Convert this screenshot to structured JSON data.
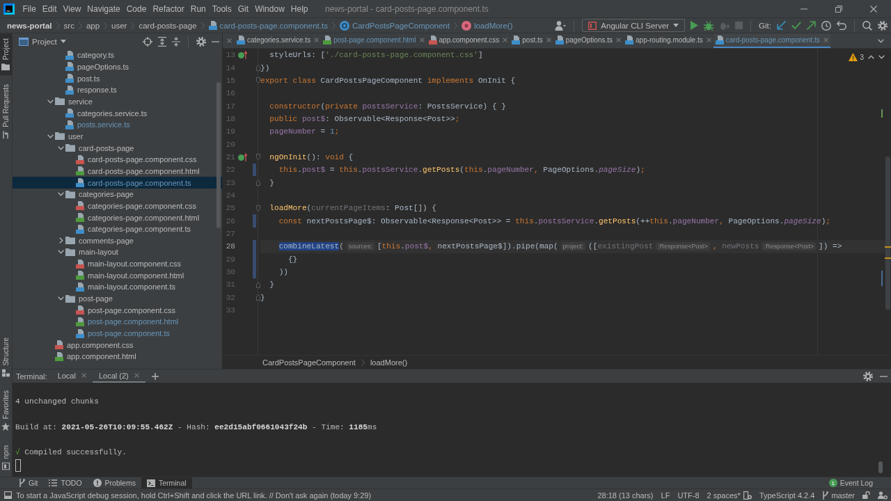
{
  "title_bar": {
    "menu": [
      "File",
      "Edit",
      "View",
      "Navigate",
      "Code",
      "Refactor",
      "Run",
      "Tools",
      "Git",
      "Window",
      "Help"
    ],
    "title": "news-portal - card-posts-page.component.ts"
  },
  "nav_bar": {
    "breadcrumbs": [
      {
        "label": "news-portal",
        "kind": "project"
      },
      {
        "label": "src",
        "kind": "folder"
      },
      {
        "label": "app",
        "kind": "folder"
      },
      {
        "label": "user",
        "kind": "folder"
      },
      {
        "label": "card-posts-page",
        "kind": "folder"
      },
      {
        "label": "card-posts-page.component.ts",
        "kind": "ts"
      },
      {
        "label": "CardPostsPageComponent",
        "kind": "class"
      },
      {
        "label": "loadMore()",
        "kind": "method"
      }
    ],
    "run_config": "Angular CLI Server",
    "git_label": "Git:"
  },
  "tool_strip": {
    "top": [
      {
        "label": "Project",
        "kind": "project",
        "selected": true
      },
      {
        "label": "Pull Requests",
        "kind": "pull_requests",
        "selected": false
      }
    ],
    "bottom": [
      {
        "label": "Structure",
        "kind": "structure",
        "selected": false
      },
      {
        "label": "Favorites",
        "kind": "favorites",
        "selected": false
      },
      {
        "label": "npm",
        "kind": "npm",
        "selected": false
      }
    ]
  },
  "project_panel": {
    "title": "Project",
    "tree": [
      {
        "children": [
          {
            "label": "category.ts",
            "kind": "ts",
            "modified": false,
            "selected": false
          },
          {
            "label": "pageOptions.ts",
            "kind": "ts",
            "modified": false,
            "selected": false
          },
          {
            "label": "post.ts",
            "kind": "ts",
            "modified": false,
            "selected": false
          },
          {
            "label": "response.ts",
            "kind": "ts",
            "modified": false,
            "selected": false
          }
        ]
      },
      {
        "label": "service",
        "kind": "folder",
        "expanded": true,
        "modified": false,
        "selected": false,
        "children": [
          {
            "label": "categories.service.ts",
            "kind": "ts",
            "modified": false,
            "selected": false
          },
          {
            "label": "posts.service.ts",
            "kind": "ts",
            "modified": true,
            "selected": false
          }
        ]
      },
      {
        "label": "user",
        "kind": "folder",
        "expanded": true,
        "modified": false,
        "selected": false,
        "children": [
          {
            "label": "card-posts-page",
            "kind": "folder",
            "expanded": true,
            "modified": false,
            "selected": false,
            "children": [
              {
                "label": "card-posts-page.component.css",
                "kind": "css",
                "modified": false,
                "selected": false
              },
              {
                "label": "card-posts-page.component.html",
                "kind": "html",
                "modified": false,
                "selected": false
              },
              {
                "label": "card-posts-page.component.ts",
                "kind": "ts",
                "modified": true,
                "selected": true
              }
            ]
          },
          {
            "label": "categories-page",
            "kind": "folder",
            "expanded": true,
            "modified": false,
            "selected": false,
            "children": [
              {
                "label": "categories-page.component.css",
                "kind": "css",
                "modified": false,
                "selected": false
              },
              {
                "label": "categories-page.component.html",
                "kind": "html",
                "modified": false,
                "selected": false
              },
              {
                "label": "categories-page.component.ts",
                "kind": "ts",
                "modified": false,
                "selected": false
              }
            ]
          },
          {
            "label": "comments-page",
            "kind": "folder",
            "expanded": false,
            "modified": false,
            "selected": false
          },
          {
            "label": "main-layout",
            "kind": "folder",
            "expanded": true,
            "modified": false,
            "selected": false,
            "children": [
              {
                "label": "main-layout.component.css",
                "kind": "css",
                "modified": false,
                "selected": false
              },
              {
                "label": "main-layout.component.html",
                "kind": "html",
                "modified": false,
                "selected": false
              },
              {
                "label": "main-layout.component.ts",
                "kind": "ts",
                "modified": false,
                "selected": false
              }
            ]
          },
          {
            "label": "post-page",
            "kind": "folder",
            "expanded": true,
            "modified": false,
            "selected": false,
            "children": [
              {
                "label": "post-page.component.css",
                "kind": "css",
                "modified": false,
                "selected": false
              },
              {
                "label": "post-page.component.html",
                "kind": "html",
                "modified": true,
                "selected": false
              },
              {
                "label": "post-page.component.ts",
                "kind": "ts",
                "modified": true,
                "selected": false
              }
            ]
          }
        ]
      },
      {
        "label": "app.component.css",
        "kind": "css",
        "modified": false,
        "selected": false
      },
      {
        "label": "app.component.html",
        "kind": "html",
        "modified": false,
        "selected": false
      }
    ]
  },
  "editor": {
    "tabs": [
      {
        "label": "categories.service.ts",
        "kind": "ts",
        "selected": false,
        "modified": false
      },
      {
        "label": "post-page.component.html",
        "kind": "html",
        "selected": false,
        "modified": true
      },
      {
        "label": "app.component.css",
        "kind": "css",
        "selected": false,
        "modified": false
      },
      {
        "label": "post.ts",
        "kind": "ts",
        "selected": false,
        "modified": false
      },
      {
        "label": "pageOptions.ts",
        "kind": "ts",
        "selected": false,
        "modified": false
      },
      {
        "label": "app-routing.module.ts",
        "kind": "ts",
        "selected": false,
        "modified": false
      },
      {
        "label": "card-posts-page.component.ts",
        "kind": "ts",
        "selected": true,
        "modified": true
      }
    ],
    "problems": "3",
    "lines": [
      {
        "number": "13",
        "kind": "plain",
        "marker": true,
        "changed": false,
        "current": false,
        "tokens": [
          {
            "text": "  styleUrls: [",
            "kind": "plain"
          },
          {
            "text": "'./card-posts-page.component.css'",
            "kind": "string"
          },
          {
            "text": "]",
            "kind": "plain"
          }
        ]
      },
      {
        "number": "14",
        "kind": "fold_end",
        "marker": false,
        "changed": false,
        "current": false,
        "tokens": [
          {
            "text": "})",
            "kind": "plain"
          }
        ]
      },
      {
        "number": "15",
        "kind": "fold_start",
        "marker": false,
        "changed": false,
        "current": false,
        "tokens": [
          {
            "text": "export class ",
            "kind": "keyword"
          },
          {
            "text": "CardPostsPageComponent ",
            "kind": "plain"
          },
          {
            "text": "implements ",
            "kind": "keyword"
          },
          {
            "text": "OnInit {",
            "kind": "plain"
          }
        ]
      },
      {
        "number": "16",
        "kind": "plain",
        "marker": false,
        "changed": false,
        "current": false
      },
      {
        "number": "17",
        "kind": "plain",
        "marker": false,
        "changed": false,
        "current": false,
        "tokens": [
          {
            "text": "  constructor",
            "kind": "keyword"
          },
          {
            "text": "(",
            "kind": "plain"
          },
          {
            "text": "private ",
            "kind": "keyword"
          },
          {
            "text": "postsService",
            "kind": "field"
          },
          {
            "text": ": PostsService) { }",
            "kind": "plain"
          }
        ]
      },
      {
        "number": "18",
        "kind": "plain",
        "marker": false,
        "changed": false,
        "current": false,
        "tokens": [
          {
            "text": "  public ",
            "kind": "keyword"
          },
          {
            "text": "post$",
            "kind": "field"
          },
          {
            "text": ": Observable<Response<Post>>",
            "kind": "plain"
          },
          {
            "text": ";",
            "kind": "keyword"
          }
        ]
      },
      {
        "number": "19",
        "kind": "plain",
        "marker": false,
        "changed": false,
        "current": false,
        "tokens": [
          {
            "text": "  pageNumber",
            "kind": "field"
          },
          {
            "text": " = ",
            "kind": "plain"
          },
          {
            "text": "1",
            "kind": "number"
          },
          {
            "text": ";",
            "kind": "keyword"
          }
        ]
      },
      {
        "number": "20",
        "kind": "plain",
        "marker": false,
        "changed": false,
        "current": false
      },
      {
        "number": "21",
        "kind": "fold_start",
        "marker": true,
        "changed": false,
        "current": false,
        "tokens": [
          {
            "text": "  ngOnInit",
            "kind": "function"
          },
          {
            "text": "(): ",
            "kind": "plain"
          },
          {
            "text": "void ",
            "kind": "keyword"
          },
          {
            "text": "{",
            "kind": "plain"
          }
        ]
      },
      {
        "number": "22",
        "kind": "plain",
        "marker": false,
        "changed": true,
        "current": false,
        "tokens": [
          {
            "text": "    this",
            "kind": "keyword"
          },
          {
            "text": ".",
            "kind": "plain"
          },
          {
            "text": "post$",
            "kind": "field"
          },
          {
            "text": " = ",
            "kind": "plain"
          },
          {
            "text": "this",
            "kind": "keyword"
          },
          {
            "text": ".",
            "kind": "plain"
          },
          {
            "text": "postsService",
            "kind": "field"
          },
          {
            "text": ".",
            "kind": "plain"
          },
          {
            "text": "getPosts",
            "kind": "function"
          },
          {
            "text": "(",
            "kind": "plain"
          },
          {
            "text": "this",
            "kind": "keyword"
          },
          {
            "text": ".",
            "kind": "plain"
          },
          {
            "text": "pageNumber",
            "kind": "field"
          },
          {
            "text": ", ",
            "kind": "keyword"
          },
          {
            "text": "PageOptions.",
            "kind": "plain"
          },
          {
            "text": "pageSize",
            "kind": "static"
          },
          {
            "text": ")",
            "kind": "plain"
          },
          {
            "text": ";",
            "kind": "keyword"
          }
        ]
      },
      {
        "number": "23",
        "kind": "fold_end",
        "marker": false,
        "changed": false,
        "current": false,
        "tokens": [
          {
            "text": "  }",
            "kind": "plain"
          }
        ]
      },
      {
        "number": "24",
        "kind": "plain",
        "marker": false,
        "changed": false,
        "current": false
      },
      {
        "number": "25",
        "kind": "fold_start",
        "marker": false,
        "changed": false,
        "current": false,
        "tokens": [
          {
            "text": "  loadMore",
            "kind": "function"
          },
          {
            "text": "(",
            "kind": "plain"
          },
          {
            "text": "currentPageItems",
            "kind": "unused"
          },
          {
            "text": ": Post[]) {",
            "kind": "plain"
          }
        ]
      },
      {
        "number": "26",
        "kind": "plain",
        "marker": false,
        "changed": true,
        "current": false,
        "tokens": [
          {
            "text": "    const ",
            "kind": "keyword"
          },
          {
            "text": "nextPostsPage$: Observable<Response<Post>> = ",
            "kind": "plain"
          },
          {
            "text": "this",
            "kind": "keyword"
          },
          {
            "text": ".",
            "kind": "plain"
          },
          {
            "text": "postsService",
            "kind": "field"
          },
          {
            "text": ".",
            "kind": "plain"
          },
          {
            "text": "getPosts",
            "kind": "function"
          },
          {
            "text": "(++",
            "kind": "plain"
          },
          {
            "text": "this",
            "kind": "keyword"
          },
          {
            "text": ".",
            "kind": "plain"
          },
          {
            "text": "pageNumber",
            "kind": "field"
          },
          {
            "text": ", ",
            "kind": "keyword"
          },
          {
            "text": "PageOptions.",
            "kind": "plain"
          },
          {
            "text": "pageSize",
            "kind": "static"
          },
          {
            "text": ")",
            "kind": "plain"
          },
          {
            "text": ";",
            "kind": "keyword"
          }
        ]
      },
      {
        "number": "27",
        "kind": "plain",
        "marker": false,
        "changed": false,
        "current": false
      },
      {
        "number": "28",
        "kind": "plain",
        "marker": false,
        "changed": true,
        "current": true,
        "tokens": [
          {
            "text": "    combineLatest",
            "kind": "selected"
          },
          {
            "text": "(",
            "kind": "plain"
          },
          {
            "text": "sources:",
            "kind": "hint"
          },
          {
            "text": "[",
            "kind": "plain"
          },
          {
            "text": "this",
            "kind": "keyword"
          },
          {
            "text": ".",
            "kind": "plain"
          },
          {
            "text": "post$",
            "kind": "field"
          },
          {
            "text": ", ",
            "kind": "keyword"
          },
          {
            "text": "nextPostsPage$]).pipe(map(",
            "kind": "plain"
          },
          {
            "text": "project:",
            "kind": "hint"
          },
          {
            "text": "([",
            "kind": "plain"
          },
          {
            "text": "existingPost",
            "kind": "unused"
          },
          {
            "text": ":Response<Post>",
            "kind": "hint"
          },
          {
            "text": ", ",
            "kind": "keyword"
          },
          {
            "text": "newPosts",
            "kind": "unused"
          },
          {
            "text": ":Response<Post>",
            "kind": "hint"
          },
          {
            "text": "]) =>",
            "kind": "plain"
          }
        ]
      },
      {
        "number": "29",
        "kind": "plain",
        "marker": false,
        "changed": true,
        "current": false,
        "tokens": [
          {
            "text": "      {}",
            "kind": "plain"
          }
        ]
      },
      {
        "number": "30",
        "kind": "plain",
        "marker": false,
        "changed": true,
        "current": false,
        "tokens": [
          {
            "text": "    ))",
            "kind": "plain"
          }
        ]
      },
      {
        "number": "31",
        "kind": "fold_end",
        "marker": false,
        "changed": false,
        "current": false,
        "tokens": [
          {
            "text": "  }",
            "kind": "plain"
          }
        ]
      },
      {
        "number": "32",
        "kind": "fold_end",
        "marker": false,
        "changed": false,
        "current": false,
        "tokens": [
          {
            "text": "}",
            "kind": "plain"
          }
        ]
      },
      {
        "number": "33",
        "kind": "plain",
        "marker": false,
        "changed": false,
        "current": false
      }
    ],
    "stripe_marks": [
      {
        "color": "#629755"
      },
      {
        "color": "#be9117"
      },
      {
        "color": "#be9117"
      },
      {
        "color": "#4a6b94"
      }
    ],
    "breadcrumbs": [
      "CardPostsPageComponent",
      "loadMore()"
    ]
  },
  "terminal": {
    "label": "Terminal:",
    "tabs": [
      {
        "label": "Local",
        "selected": false
      },
      {
        "label": "Local (2)",
        "selected": true
      }
    ],
    "lines": [
      {
        "kind": "output",
        "text": "4 unchanged chunks"
      },
      {
        "kind": "output",
        "text": "Build at: **2021-05-26T10:09:55.462Z** - Hash: **ee2d15abf0661043f24b** - Time: **1185**ms"
      },
      {
        "kind": "success",
        "symbol": "√",
        "text": "Compiled successfully."
      }
    ],
    "cursor": true
  },
  "tool_windows": [
    {
      "label": "Git",
      "kind": "git",
      "selected": false
    },
    {
      "label": "TODO",
      "kind": "todo",
      "selected": false
    },
    {
      "label": "Problems",
      "kind": "problems",
      "selected": false
    },
    {
      "label": "Terminal",
      "kind": "terminal",
      "selected": true
    }
  ],
  "event_log": {
    "count": "1",
    "label": "Event Log"
  },
  "status_bar": {
    "message": "To start a JavaScript debug session, hold Ctrl+Shift and click the URL link. // Don't ask again (today 9:29)",
    "items": [
      {
        "text": "28:18 (13 chars)",
        "kind": "plain"
      },
      {
        "text": "LF",
        "kind": "plain"
      },
      {
        "text": "UTF-8",
        "kind": "plain"
      },
      {
        "text": "2 spaces*",
        "kind": "indent"
      },
      {
        "text": "TypeScript 4.2.4",
        "kind": "plain"
      },
      {
        "text": "master",
        "kind": "branch"
      }
    ]
  }
}
